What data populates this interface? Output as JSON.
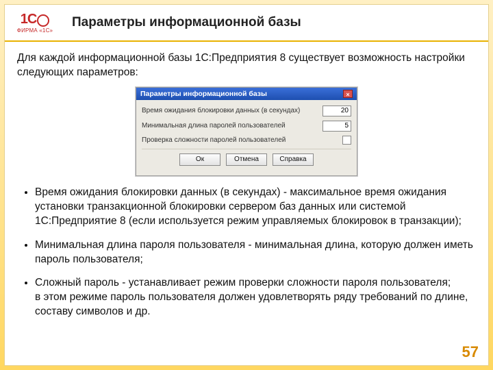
{
  "logo": {
    "text": "1С",
    "sub": "ФИРМА «1С»"
  },
  "title": "Параметры информационной базы",
  "intro": "Для каждой информационной базы 1С:Предприятия 8 существует возможность настройки следующих параметров:",
  "dialog": {
    "title": "Параметры информационной базы",
    "row1_label": "Время ожидания блокировки данных (в секундах)",
    "row1_value": "20",
    "row2_label": "Минимальная длина паролей пользователей",
    "row2_value": "5",
    "row3_label": "Проверка сложности паролей пользователей",
    "btn_ok": "Ок",
    "btn_cancel": "Отмена",
    "btn_help": "Справка"
  },
  "bullets": [
    "Время ожидания блокировки данных (в секундах) - максимальное время ожидания установки транзакционной блокировки сервером баз данных или системой 1С:Предприятие 8 (если используется режим управляемых блокировок в транзакции);",
    "Минимальная длина пароля пользователя - минимальная длина, которую должен иметь пароль пользователя;",
    "Сложный пароль - устанавливает режим проверки сложности пароля пользователя;\nв этом режиме пароль пользователя должен удовлетворять ряду требований по длине, составу символов и др."
  ],
  "page": "57"
}
